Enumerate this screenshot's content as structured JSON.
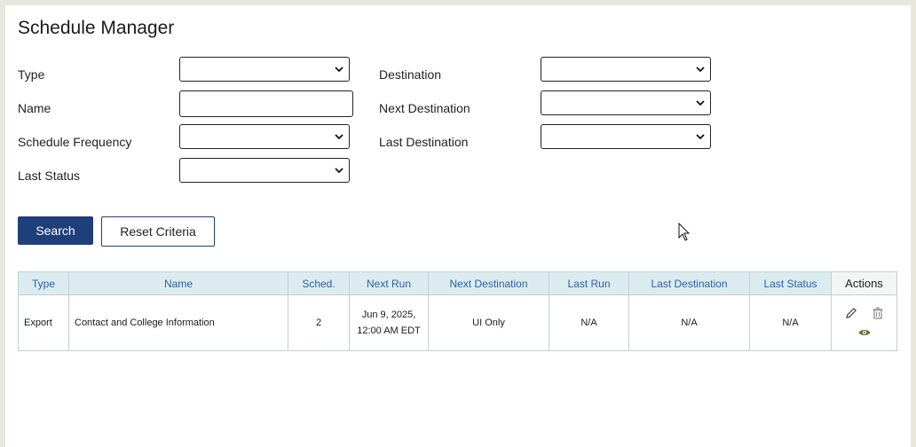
{
  "page": {
    "title": "Schedule Manager"
  },
  "filters": {
    "type_label": "Type",
    "name_label": "Name",
    "frequency_label": "Schedule Frequency",
    "last_status_label": "Last Status",
    "destination_label": "Destination",
    "next_destination_label": "Next Destination",
    "last_destination_label": "Last Destination",
    "type_value": "",
    "name_value": "",
    "frequency_value": "",
    "last_status_value": "",
    "destination_value": "",
    "next_destination_value": "",
    "last_destination_value": ""
  },
  "buttons": {
    "search": "Search",
    "reset": "Reset Criteria"
  },
  "table": {
    "headers": {
      "type": "Type",
      "name": "Name",
      "sched": "Sched.",
      "next_run": "Next Run",
      "next_destination": "Next Destination",
      "last_run": "Last Run",
      "last_destination": "Last Destination",
      "last_status": "Last Status",
      "actions": "Actions"
    },
    "rows": [
      {
        "type": "Export",
        "name": "Contact and College Information",
        "sched": "2",
        "next_run_line1": "Jun 9, 2025,",
        "next_run_line2": "12:00 AM EDT",
        "next_destination": "UI Only",
        "last_run": "N/A",
        "last_destination": "N/A",
        "last_status": "N/A",
        "actions": [
          "edit-icon",
          "delete-icon",
          "view-icon"
        ]
      }
    ]
  },
  "colors": {
    "primary": "#1f3f7a",
    "header_bg": "#dcebef",
    "header_text": "#2a62a8",
    "view_icon": "#5a7a2a"
  }
}
